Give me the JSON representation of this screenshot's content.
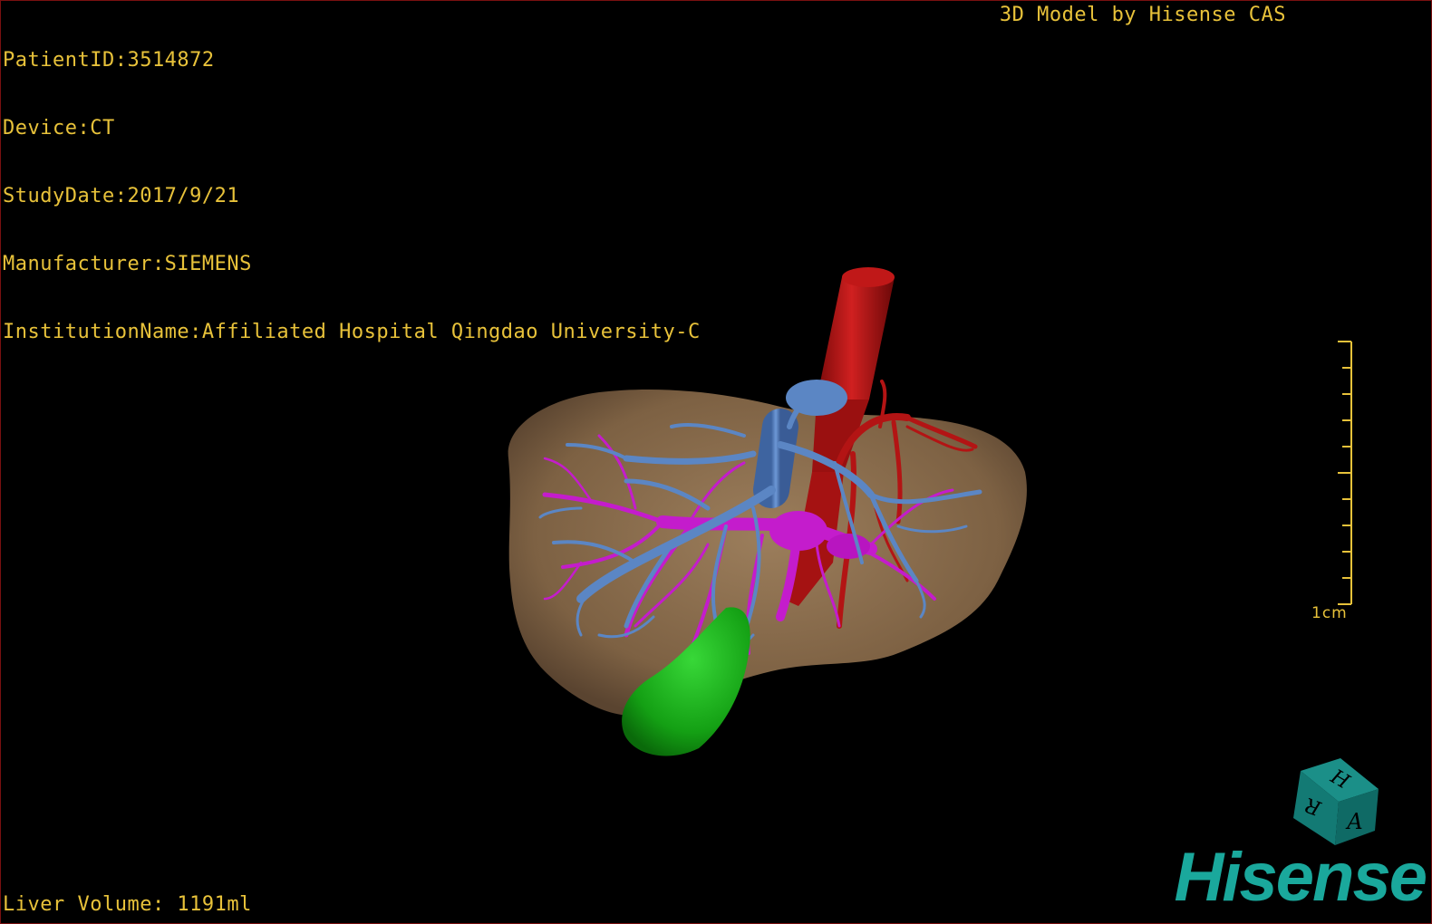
{
  "header": {
    "patient_id": "PatientID:3514872",
    "device": "Device:CT",
    "study_date": "StudyDate:2017/9/21",
    "manufacturer": "Manufacturer:SIEMENS",
    "institution": "InstitutionName:Affiliated Hospital Qingdao University-C",
    "model_credit": "3D Model by Hisense CAS"
  },
  "footer": {
    "liver_volume": "Liver Volume: 1191ml"
  },
  "scale_bar": {
    "label": "1cm"
  },
  "orientation_cube": {
    "faces": [
      "H",
      "R",
      "A"
    ]
  },
  "brand": {
    "logo_text": "Hisense"
  },
  "colors": {
    "overlay_text": "#e8c23a",
    "liver": "#8a6e4e",
    "hepatic_vein": "#5b86c4",
    "portal_vein": "#c41ccc",
    "artery": "#b31414",
    "gallbladder": "#18a818",
    "brand": "#1aa89c",
    "cube": "#137a74"
  },
  "icons": {
    "orientation_cube": "orientation-cube-icon",
    "scale_ruler": "scale-ruler-icon"
  }
}
